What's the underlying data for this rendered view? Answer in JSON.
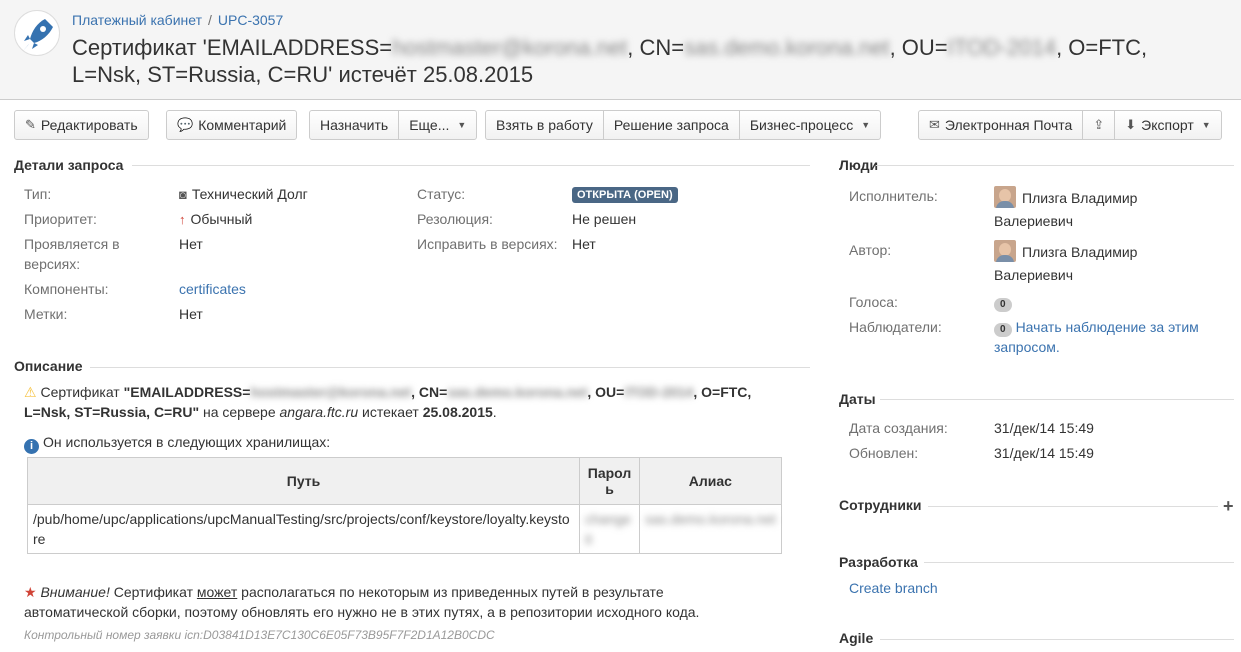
{
  "breadcrumb": {
    "project": "Платежный кабинет",
    "separator": "/",
    "key": "UPC-3057"
  },
  "title": {
    "pre": "Сертификат 'EMAILADDRESS=",
    "email": "hostmaster@korona.net",
    "cn_label": ", CN=",
    "cn": "sas.demo.korona.net",
    "ou_label": ", OU=",
    "ou": "ITOD-2014",
    "post": ", O=FTC, L=Nsk, ST=Russia, C=RU' истечёт 25.08.2015"
  },
  "toolbar": {
    "edit": "Редактировать",
    "comment": "Комментарий",
    "assign": "Назначить",
    "more": "Еще...",
    "start": "Взять в работу",
    "resolve": "Решение запроса",
    "workflow": "Бизнес-процесс",
    "email": "Электронная Почта",
    "export": "Экспорт"
  },
  "details": {
    "heading": "Детали запроса",
    "type_label": "Тип:",
    "type": "Технический Долг",
    "priority_label": "Приоритет:",
    "priority": "Обычный",
    "affects_label": "Проявляется в версиях:",
    "affects": "Нет",
    "components_label": "Компоненты:",
    "components": "certificates",
    "labels_label": "Метки:",
    "labels": "Нет",
    "status_label": "Статус:",
    "status": "ОТКРЫТА (OPEN)",
    "resolution_label": "Резолюция:",
    "resolution": "Не решен",
    "fix_label": "Исправить в версиях:",
    "fix": "Нет"
  },
  "description": {
    "heading": "Описание",
    "w1": "Сертификат ",
    "b1": "\"EMAILADDRESS=",
    "b2": ", CN=",
    "b3": ", OU=",
    "b4": ", O=FTC,",
    "line2b": "L=Nsk, ST=Russia, C=RU\"",
    "line2a": " на сервере ",
    "server": "angara.ftc.ru",
    "line2c": " истекает ",
    "date": "25.08.2015",
    "line2d": ".",
    "info": "Он используется в следующих хранилищах:",
    "col_path": "Путь",
    "col_pass": "Пароль",
    "col_alias": "Алиас",
    "path": "/pub/home/upc/applications/upcManualTesting/src/projects/conf/keystore/loyalty.keystore",
    "pass": "changeit",
    "alias": "sas.demo.korona.net",
    "warn_em": "Внимание!",
    "warn1": " Сертификат ",
    "warn_u": "может",
    "warn2": " располагаться по некоторым из приведенных путей в результате",
    "warn3": "автоматической сборки, поэтому обновлять его нужно не в этих путях, а в репозитории исходного кода.",
    "control": "Контрольный номер заявки icn:D03841D13E7C130C6E05F73B95F7F2D1A12B0CDC"
  },
  "people": {
    "heading": "Люди",
    "assignee_label": "Исполнитель:",
    "assignee1": "Плизга Владимир",
    "assignee2": "Валериевич",
    "reporter_label": "Автор:",
    "reporter1": "Плизга Владимир",
    "reporter2": "Валериевич",
    "votes_label": "Голоса:",
    "votes": "0",
    "watchers_label": "Наблюдатели:",
    "watchers": "0",
    "watch_link1": "Начать наблюдение за этим",
    "watch_link2": "запросом."
  },
  "dates": {
    "heading": "Даты",
    "created_label": "Дата создания:",
    "created": "31/дек/14 15:49",
    "updated_label": "Обновлен:",
    "updated": "31/дек/14 15:49"
  },
  "staff": {
    "heading": "Сотрудники",
    "add": "+"
  },
  "dev": {
    "heading": "Разработка",
    "create_branch": "Create branch"
  },
  "agile": {
    "heading": "Agile"
  }
}
